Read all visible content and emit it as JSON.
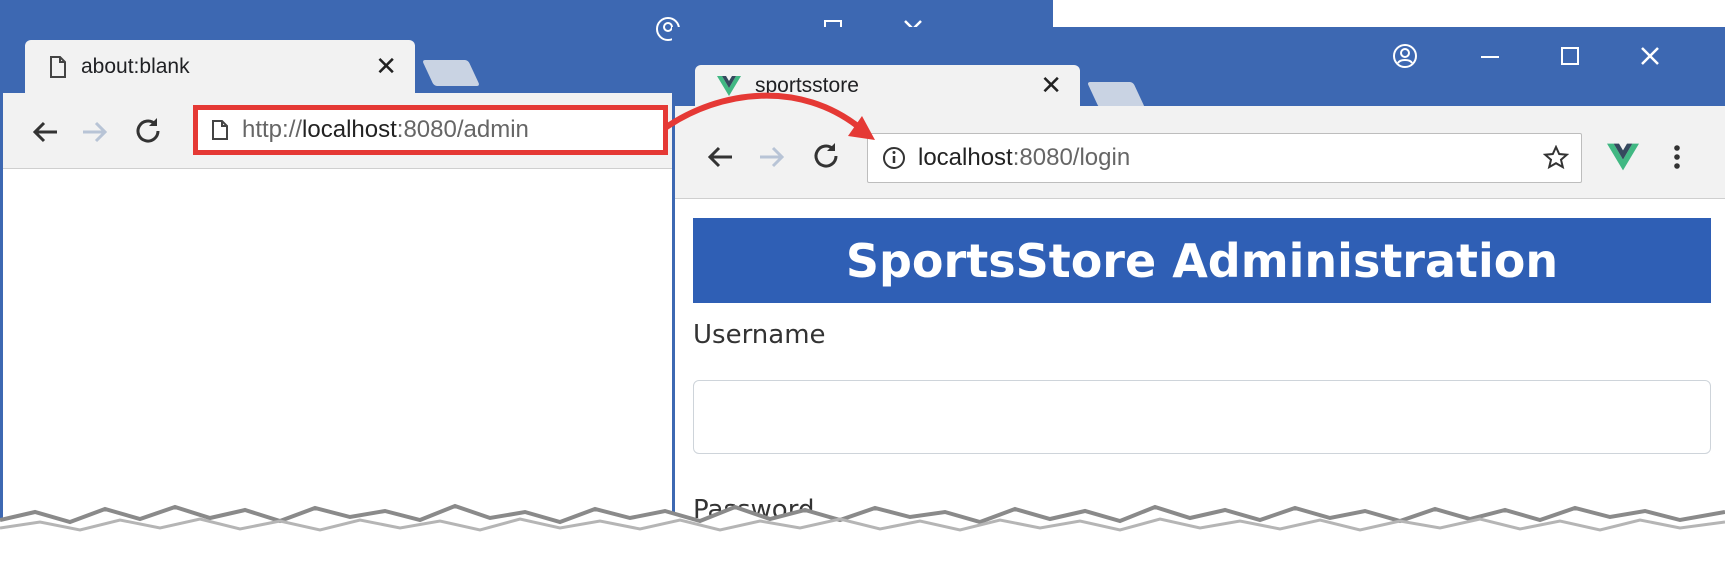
{
  "back_window": {
    "tab": {
      "title": "about:blank",
      "icon": "page-icon",
      "close": "✕"
    },
    "omnibox": {
      "scheme": "http://",
      "host": "localhost",
      "port_path": ":8080/admin",
      "icon": "page-icon"
    },
    "icons": {
      "back": "back-arrow-icon",
      "forward": "forward-arrow-icon",
      "reload": "reload-icon"
    }
  },
  "front_window": {
    "tab": {
      "title": "sportsstore",
      "icon": "vue-logo-icon",
      "close": "✕"
    },
    "omnibox": {
      "host": "localhost",
      "port_path": ":8080/login",
      "icon": "info-icon",
      "bookmark_icon": "star-icon"
    },
    "icons": {
      "back": "back-arrow-icon",
      "forward": "forward-arrow-icon",
      "reload": "reload-icon",
      "extension": "vue-logo-icon",
      "menu": "kebab-menu-icon"
    },
    "window_controls": {
      "profile": "profile-icon",
      "minimize": "—",
      "maximize": "☐",
      "close": "✕"
    }
  },
  "page": {
    "header": "SportsStore Administration",
    "username_label": "Username",
    "username_value": "",
    "password_label": "Password"
  },
  "colors": {
    "chrome_frame": "#3d68b2",
    "header_bg": "#2f5fb5",
    "highlight": "#e53935"
  }
}
